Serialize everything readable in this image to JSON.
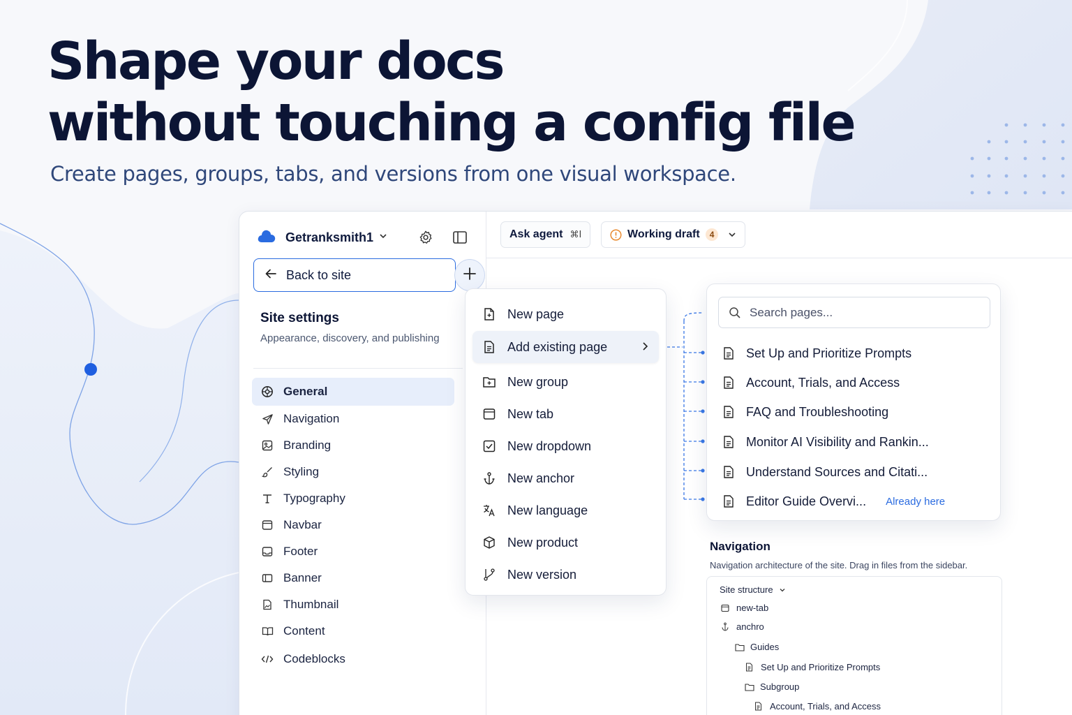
{
  "hero": {
    "title_line1": "Shape your docs",
    "title_line2": "without touching a config file",
    "subtitle": "Create pages, groups, tabs, and versions from one visual workspace."
  },
  "colors": {
    "accent": "#2a6be0",
    "ink": "#0c1535",
    "warning": "#e8892e"
  },
  "sidebar": {
    "workspace_name": "Getranksmith1",
    "back_label": "Back to site",
    "settings_title": "Site settings",
    "settings_desc": "Appearance, discovery, and publishing",
    "items": [
      {
        "label": "General",
        "icon": "globe-icon",
        "active": true
      },
      {
        "label": "Navigation",
        "icon": "send-icon"
      },
      {
        "label": "Branding",
        "icon": "image-icon"
      },
      {
        "label": "Styling",
        "icon": "brush-icon"
      },
      {
        "label": "Typography",
        "icon": "type-icon"
      },
      {
        "label": "Navbar",
        "icon": "navbar-icon"
      },
      {
        "label": "Footer",
        "icon": "footer-icon"
      },
      {
        "label": "Banner",
        "icon": "banner-icon"
      },
      {
        "label": "Thumbnail",
        "icon": "thumbnail-icon"
      },
      {
        "label": "Content",
        "icon": "book-icon"
      },
      {
        "label": "Codeblocks",
        "icon": "code-icon"
      }
    ]
  },
  "topbar": {
    "ask_agent": "Ask agent",
    "ask_shortcut": "⌘I",
    "draft_label": "Working draft",
    "draft_count": "4"
  },
  "menu": {
    "items": [
      {
        "label": "New page",
        "icon": "file-plus-icon"
      },
      {
        "label": "Add existing page",
        "icon": "file-text-icon",
        "highlighted": true
      },
      {
        "label": "New group",
        "icon": "folder-plus-icon"
      },
      {
        "label": "New tab",
        "icon": "tab-icon"
      },
      {
        "label": "New dropdown",
        "icon": "checkbox-icon"
      },
      {
        "label": "New anchor",
        "icon": "anchor-icon"
      },
      {
        "label": "New language",
        "icon": "translate-icon"
      },
      {
        "label": "New product",
        "icon": "box-icon"
      },
      {
        "label": "New version",
        "icon": "git-branch-icon"
      }
    ]
  },
  "pages_popover": {
    "search_placeholder": "Search pages...",
    "items": [
      {
        "label": "Set Up and Prioritize Prompts"
      },
      {
        "label": "Account, Trials, and Access"
      },
      {
        "label": "FAQ and Troubleshooting"
      },
      {
        "label": "Monitor AI Visibility and Rankin..."
      },
      {
        "label": "Understand Sources and Citati..."
      },
      {
        "label": "Editor Guide Overvi...",
        "note": "Already here"
      }
    ]
  },
  "navigation_section": {
    "title": "Navigation",
    "description": "Navigation architecture of the site. Drag in files from the sidebar.",
    "structure_label": "Site structure",
    "tree": [
      {
        "label": "new-tab",
        "icon": "tab-icon"
      },
      {
        "label": "anchro",
        "icon": "anchor-icon"
      },
      {
        "label": "Guides",
        "icon": "folder-icon"
      },
      {
        "label": "Set Up and Prioritize Prompts",
        "icon": "file-text-icon"
      },
      {
        "label": "Subgroup",
        "icon": "folder-icon"
      },
      {
        "label": "Account, Trials, and Access",
        "icon": "file-text-icon"
      }
    ]
  }
}
